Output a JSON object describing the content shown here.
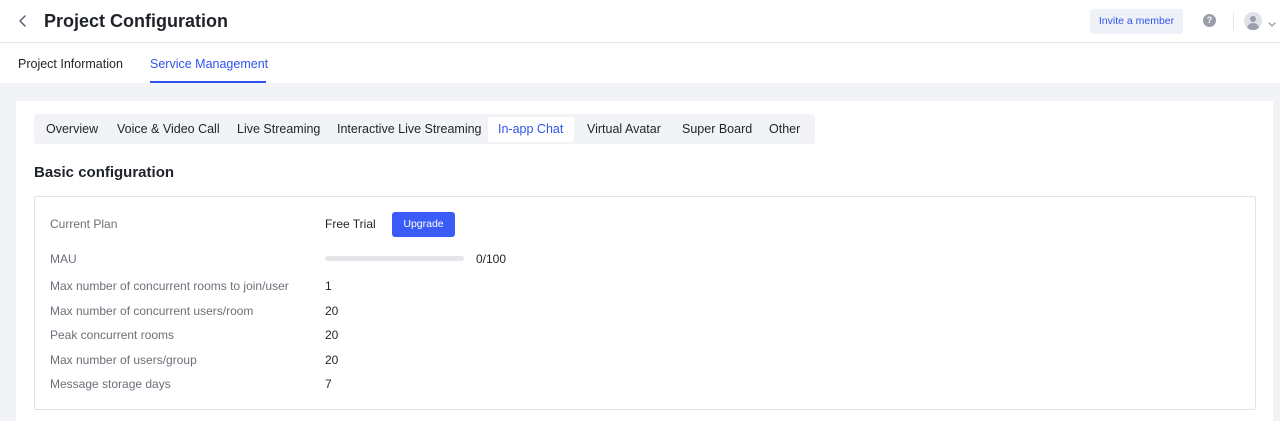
{
  "header": {
    "title": "Project Configuration",
    "invite_label": "Invite a member",
    "help_glyph": "?"
  },
  "page_tabs": [
    {
      "label": "Project Information",
      "active": false
    },
    {
      "label": "Service Management",
      "active": true
    }
  ],
  "service_tabs": [
    {
      "label": "Overview",
      "active": false
    },
    {
      "label": "Voice & Video Call",
      "active": false
    },
    {
      "label": "Live Streaming",
      "active": false
    },
    {
      "label": "Interactive Live Streaming",
      "active": false
    },
    {
      "label": "In-app Chat",
      "active": true
    },
    {
      "label": "Virtual Avatar",
      "active": false
    },
    {
      "label": "Super Board",
      "active": false
    },
    {
      "label": "Other",
      "active": false
    }
  ],
  "section": {
    "title": "Basic configuration"
  },
  "config": {
    "current_plan": {
      "label": "Current Plan",
      "value": "Free Trial",
      "upgrade_label": "Upgrade"
    },
    "mau": {
      "label": "MAU",
      "value": "0/100",
      "progress_fraction": 0
    },
    "rows": [
      {
        "label": "Max number of concurrent rooms to join/user",
        "value": "1"
      },
      {
        "label": "Max number of concurrent users/room",
        "value": "20"
      },
      {
        "label": "Peak concurrent rooms",
        "value": "20"
      },
      {
        "label": "Max number of users/group",
        "value": "20"
      },
      {
        "label": "Message storage days",
        "value": "7"
      }
    ]
  },
  "colors": {
    "accent": "#2f54eb",
    "button": "#3a5bf6",
    "background_gray": "#f2f3f6"
  },
  "icons": [
    "chevron-left-icon",
    "help-icon",
    "user-avatar-icon",
    "chevron-down-icon"
  ]
}
